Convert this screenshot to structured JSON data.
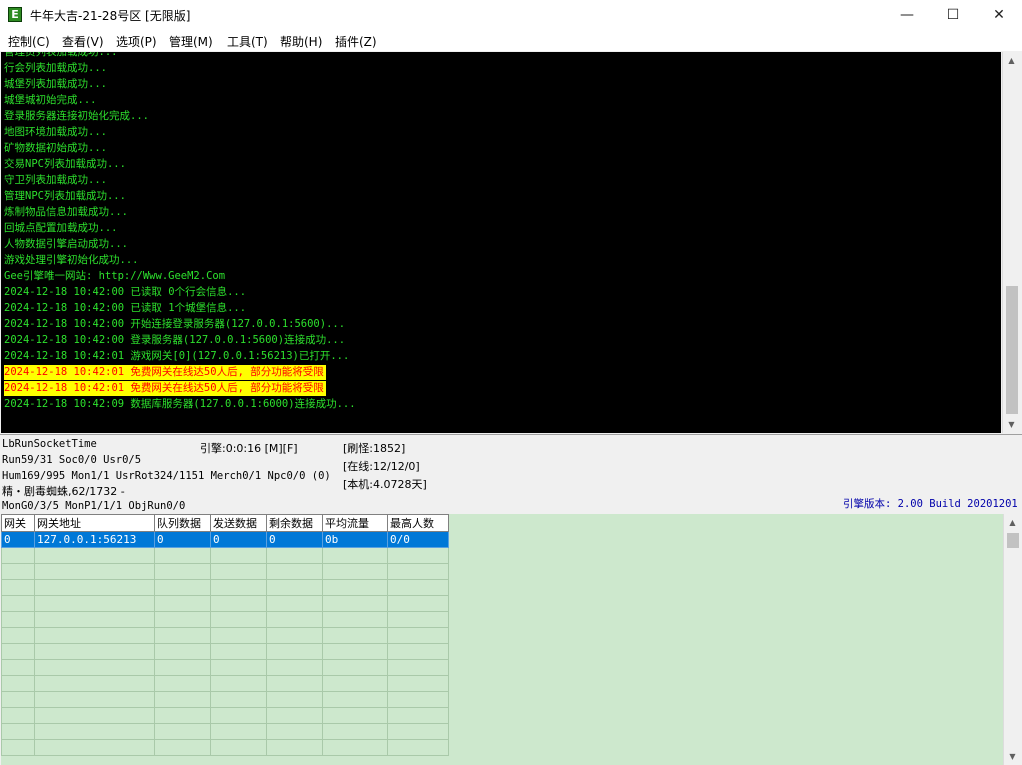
{
  "window": {
    "title": "牛年大吉-21-28号区 [无限版]",
    "icon": "app-e-icon",
    "minimize": "—",
    "maximize": "☐",
    "close": "✕"
  },
  "menu": [
    "控制(C)",
    "查看(V)",
    "选项(P)",
    "管理(M)",
    "工具(T)",
    "帮助(H)",
    "插件(Z)"
  ],
  "log": [
    {
      "text": "管理员列表加载成功...",
      "warn": false
    },
    {
      "text": "行会列表加载成功...",
      "warn": false
    },
    {
      "text": "城堡列表加载成功...",
      "warn": false
    },
    {
      "text": "城堡城初始完成...",
      "warn": false
    },
    {
      "text": "登录服务器连接初始化完成...",
      "warn": false
    },
    {
      "text": "地图环境加载成功...",
      "warn": false
    },
    {
      "text": "矿物数据初始成功...",
      "warn": false
    },
    {
      "text": "交易NPC列表加载成功...",
      "warn": false
    },
    {
      "text": "守卫列表加载成功...",
      "warn": false
    },
    {
      "text": "管理NPC列表加载成功...",
      "warn": false
    },
    {
      "text": "炼制物品信息加载成功...",
      "warn": false
    },
    {
      "text": "回城点配置加载成功...",
      "warn": false
    },
    {
      "text": "人物数据引擎启动成功...",
      "warn": false
    },
    {
      "text": "游戏处理引擎初始化成功...",
      "warn": false
    },
    {
      "text": "Gee引擎唯一网站: http://Www.GeeM2.Com",
      "warn": false
    },
    {
      "text": "2024-12-18 10:42:00 已读取 0个行会信息...",
      "warn": false
    },
    {
      "text": "2024-12-18 10:42:00 已读取 1个城堡信息...",
      "warn": false
    },
    {
      "text": "2024-12-18 10:42:00 开始连接登录服务器(127.0.0.1:5600)...",
      "warn": false
    },
    {
      "text": "2024-12-18 10:42:00 登录服务器(127.0.0.1:5600)连接成功...",
      "warn": false
    },
    {
      "text": "2024-12-18 10:42:01 游戏网关[0](127.0.0.1:56213)已打开...",
      "warn": false
    },
    {
      "text": "2024-12-18 10:42:01 免费网关在线达50人后, 部分功能将受限",
      "warn": true
    },
    {
      "text": "2024-12-18 10:42:01 免费网关在线达50人后, 部分功能将受限",
      "warn": true
    },
    {
      "text": "2024-12-18 10:42:09 数据库服务器(127.0.0.1:6000)连接成功...",
      "warn": false
    }
  ],
  "status": {
    "socket_time": "LbRunSocketTime",
    "run": "Run59/31 Soc0/0 Usr0/5",
    "hum": "Hum169/995 Mon1/1 UsrRot324/1151 Merch0/1 Npc0/0 (0)",
    "monster": "精・剧毒蜘蛛,62/1732 -",
    "mon": "MonG0/3/5 MonP1/1/1 ObjRun0/0",
    "engine": "引擎:0:0:16 [M][F]",
    "refresh": "[刷怪:1852]",
    "online": "[在线:12/12/0]",
    "local": "[本机:4.0728天]",
    "version": "引擎版本: 2.00 Build 20201201"
  },
  "grid": {
    "columns": [
      "网关",
      "网关地址",
      "队列数据",
      "发送数据",
      "剩余数据",
      "平均流量",
      "最高人数"
    ],
    "rows": [
      [
        "0",
        "127.0.0.1:56213",
        "0",
        "0",
        "0",
        "0b",
        "0/0"
      ]
    ]
  }
}
